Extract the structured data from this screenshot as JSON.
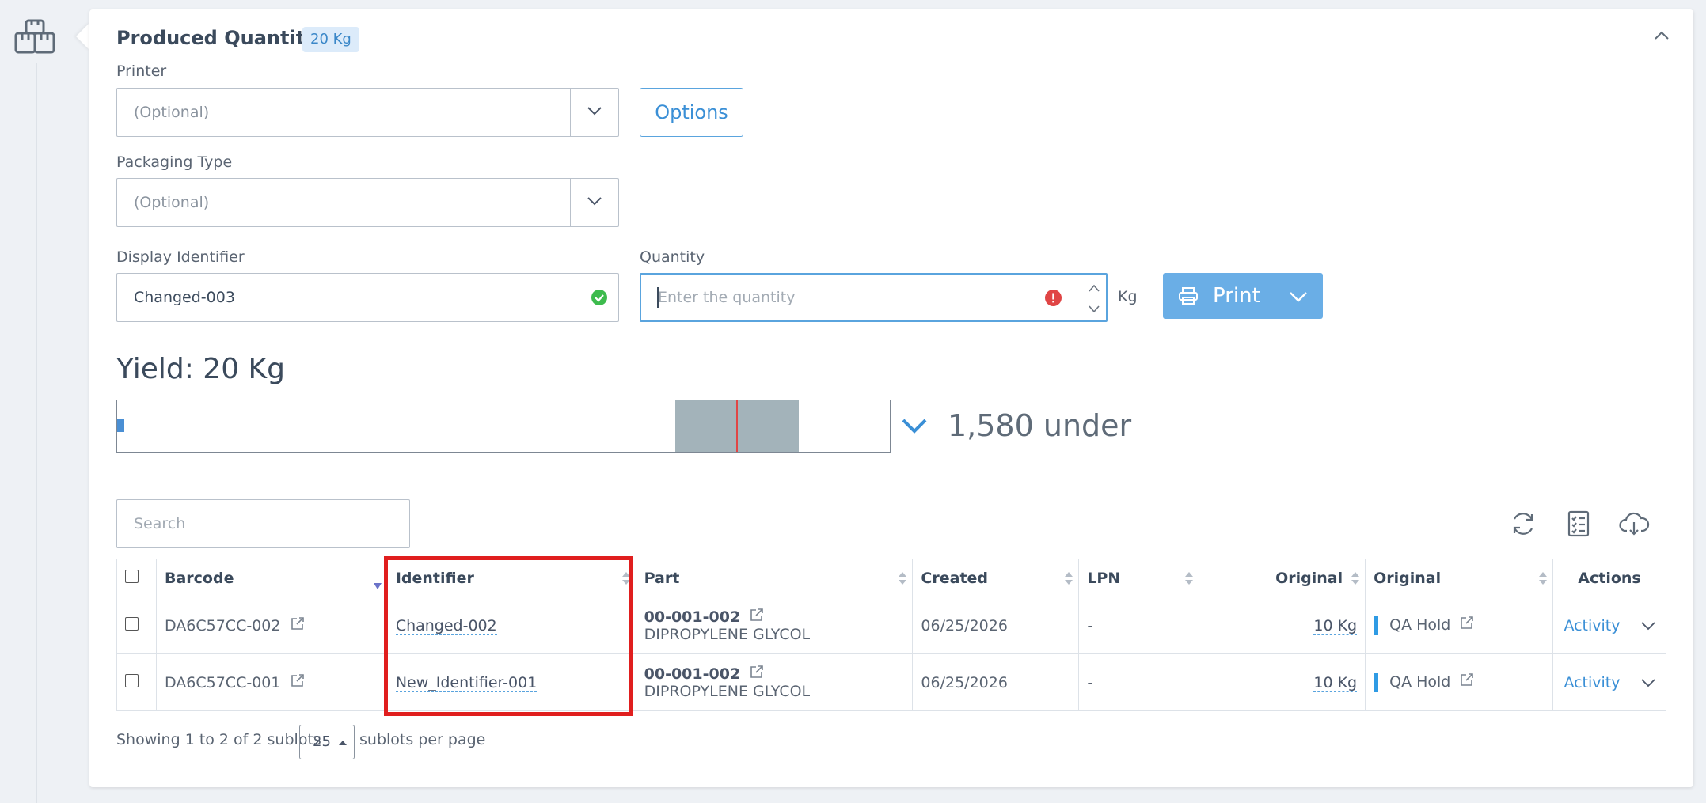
{
  "section": {
    "title": "Produced Quantity",
    "badge": "20 Kg"
  },
  "printer": {
    "label": "Printer",
    "placeholder": "(Optional)"
  },
  "options_button": "Options",
  "packaging": {
    "label": "Packaging Type",
    "placeholder": "(Optional)"
  },
  "display_identifier": {
    "label": "Display Identifier",
    "value": "Changed-003"
  },
  "quantity": {
    "label": "Quantity",
    "placeholder": "Enter the quantity",
    "unit": "Kg"
  },
  "print_button": "Print",
  "yield": {
    "title": "Yield: 20 Kg",
    "under_text": "1,580 under"
  },
  "search": {
    "placeholder": "Search"
  },
  "table": {
    "columns": [
      "Barcode",
      "Identifier",
      "Part",
      "Created",
      "LPN",
      "Original",
      "Original",
      "Actions"
    ],
    "rows": [
      {
        "barcode": "DA6C57CC-002",
        "identifier": "Changed-002",
        "part_no": "00-001-002",
        "part_name": "DIPROPYLENE GLYCOL",
        "created": "06/25/2026",
        "lpn": "-",
        "original_qty": "10 Kg",
        "status": "QA Hold",
        "action": "Activity"
      },
      {
        "barcode": "DA6C57CC-001",
        "identifier": "New_Identifier-001",
        "part_no": "00-001-002",
        "part_name": "DIPROPYLENE GLYCOL",
        "created": "06/25/2026",
        "lpn": "-",
        "original_qty": "10 Kg",
        "status": "QA Hold",
        "action": "Activity"
      }
    ]
  },
  "footer": {
    "showing": "Showing 1 to 2 of 2 sublots",
    "per_page": "25",
    "per_page_suffix": "sublots per page"
  },
  "colors": {
    "accent": "#3a8fd6",
    "highlight": "#e01e1e",
    "status": "#2f9be4"
  }
}
